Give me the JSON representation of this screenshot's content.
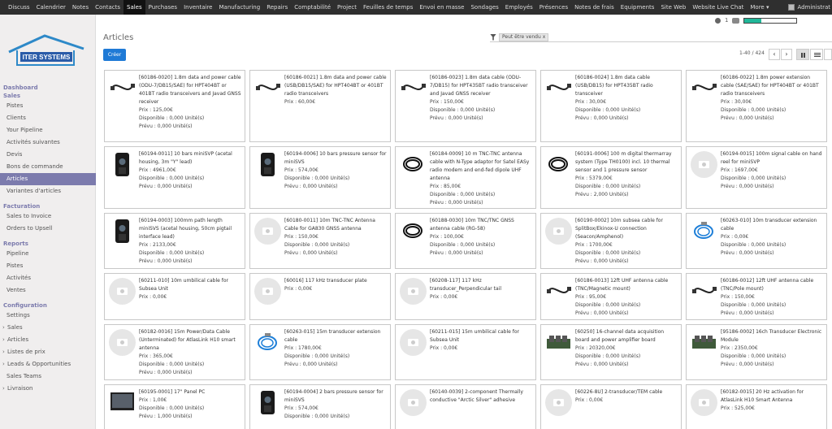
{
  "topbar": {
    "menu": [
      "Discuss",
      "Calendrier",
      "Notes",
      "Contacts",
      "Sales",
      "Purchases",
      "Inventaire",
      "Manufacturing",
      "Repairs",
      "Comptabilité",
      "Project",
      "Feuilles de temps",
      "Envoi en masse",
      "Sondages",
      "Employés",
      "Présences",
      "Notes de frais",
      "Equipments",
      "Site Web",
      "Website Live Chat",
      "More ▾"
    ],
    "active_menu": "Sales",
    "user": "Administrat",
    "notif_count": "1",
    "progress": 0.32,
    "accent": "#21b799"
  },
  "sidebar": {
    "logo_text": "ITER SYSTEMS",
    "groups": [
      {
        "title": "Dashboard",
        "items": []
      },
      {
        "title": "Sales",
        "items": [
          {
            "label": "Pistes"
          },
          {
            "label": "Clients"
          },
          {
            "label": "Your Pipeline"
          },
          {
            "label": "Activités suivantes"
          },
          {
            "label": "Devis"
          },
          {
            "label": "Bons de commande"
          },
          {
            "label": "Articles",
            "active": true
          },
          {
            "label": "Variantes d'articles"
          }
        ]
      },
      {
        "title": "Facturation",
        "items": [
          {
            "label": "Sales to Invoice"
          },
          {
            "label": "Orders to Upsell"
          }
        ]
      },
      {
        "title": "Reports",
        "items": [
          {
            "label": "Pipeline"
          },
          {
            "label": "Pistes"
          },
          {
            "label": "Activités"
          },
          {
            "label": "Ventes"
          }
        ]
      },
      {
        "title": "Configuration",
        "items": [
          {
            "label": "Settings"
          },
          {
            "label": "Sales",
            "caret": true
          },
          {
            "label": "Articles",
            "caret": true
          },
          {
            "label": "Listes de prix",
            "caret": true
          },
          {
            "label": "Leads & Opportunities",
            "caret": true
          },
          {
            "label": "Sales Teams"
          },
          {
            "label": "Livraison",
            "caret": true
          }
        ]
      }
    ],
    "accent": "#7c7bad"
  },
  "control": {
    "title": "Articles",
    "create_label": "Créer",
    "search_facet": "Peut être vendu",
    "pager": "1-40 / 424",
    "prev": "‹",
    "next": "›"
  },
  "products": [
    {
      "name": "[60186-0020] 1.8m data and power cable (ODU-7/DB15/SAE) for HPT404BT or 401BT radio transceivers and Javad GNSS receiver",
      "price": "Prix : 125,00€",
      "dispo": "Disponible : 0,000 Unité(s)",
      "prevu": "Prévu : 0,000 Unité(s)",
      "icon": "cable-icon"
    },
    {
      "name": "[60186-0021] 1.8m data and power cable (USB/DB15/SAE) for HPT404BT or 401BT radio transceivers",
      "price": "Prix : 60,00€",
      "dispo": "",
      "prevu": "",
      "icon": "cable-icon"
    },
    {
      "name": "[60186-0023] 1.8m data cable (ODU-7/DB15) for HPT435BT radio transceiver and Javad GNSS receiver",
      "price": "Prix : 150,00€",
      "dispo": "Disponible : 0,000 Unité(s)",
      "prevu": "Prévu : 0,000 Unité(s)",
      "icon": "cable-icon"
    },
    {
      "name": "[60186-0024] 1.8m data cable (USB/DB15) for HPT435BT radio transceiver",
      "price": "Prix : 30,00€",
      "dispo": "Disponible : 0,000 Unité(s)",
      "prevu": "Prévu : 0,000 Unité(s)",
      "icon": "cable-icon"
    },
    {
      "name": "[60186-0022] 1.8m power extension cable (SAE/SAE) for HPT404BT or 401BT radio transceivers",
      "price": "Prix : 30,00€",
      "dispo": "Disponible : 0,000 Unité(s)",
      "prevu": "Prévu : 0,000 Unité(s)",
      "icon": "cable-icon"
    },
    {
      "name": "[60194-0011] 10 bars miniSVP (acetal housing, 3m \"Y\" lead)",
      "price": "Prix : 4961,00€",
      "dispo": "Disponible : 0,000 Unité(s)",
      "prevu": "Prévu : 0,000 Unité(s)",
      "icon": "sensor-icon"
    },
    {
      "name": "[60194-0006] 10 bars pressure sensor for miniSVS",
      "price": "Prix : 574,00€",
      "dispo": "Disponible : 0,000 Unité(s)",
      "prevu": "Prévu : 0,000 Unité(s)",
      "icon": "sensor-icon"
    },
    {
      "name": "[60184-0009] 10 m TNC-TNC antenna cable with N-Type adaptor for Satel EASy radio modem and end-fed dipole UHF antenna",
      "price": "Prix : 85,00€",
      "dispo": "Disponible : 0,000 Unité(s)",
      "prevu": "Prévu : 0,000 Unité(s)",
      "icon": "coil-icon"
    },
    {
      "name": "[60191-0006] 100 m digital thermarray system (Type TH0100) incl. 10 thermal sensor and 1 pressure sensor",
      "price": "Prix : 5379,00€",
      "dispo": "Disponible : 0,000 Unité(s)",
      "prevu": "Prévu : 2,000 Unité(s)",
      "icon": "coil-icon"
    },
    {
      "name": "[60194-0015] 100m signal cable on hand reel for miniSVP",
      "price": "Prix : 1697,00€",
      "dispo": "Disponible : 0,000 Unité(s)",
      "prevu": "Prévu : 0,000 Unité(s)",
      "icon": "placeholder-icon"
    },
    {
      "name": "[60194-0003] 100mm path length miniSVS (acetal housing, 50cm pigtail interface lead)",
      "price": "Prix : 2133,00€",
      "dispo": "Disponible : 0,000 Unité(s)",
      "prevu": "Prévu : 0,000 Unité(s)",
      "icon": "sensor-icon"
    },
    {
      "name": "[60180-0011] 10m TNC-TNC Antenna Cable for GA830 GNSS antenna",
      "price": "Prix : 150,00€",
      "dispo": "Disponible : 0,000 Unité(s)",
      "prevu": "Prévu : 0,000 Unité(s)",
      "icon": "placeholder-icon"
    },
    {
      "name": "[60188-0030] 10m TNC/TNC GNSS antenna cable (RG-58)",
      "price": "Prix : 100,00€",
      "dispo": "Disponible : 0,000 Unité(s)",
      "prevu": "Prévu : 0,000 Unité(s)",
      "icon": "coil-icon"
    },
    {
      "name": "[60190-0002] 10m subsea cable for SplitBox/Ekinox-U connection (Seacon/Amphenol)",
      "price": "Prix : 1700,00€",
      "dispo": "Disponible : 0,000 Unité(s)",
      "prevu": "Prévu : 0,000 Unité(s)",
      "icon": "placeholder-icon"
    },
    {
      "name": "[60263-010] 10m transducer extension cable",
      "price": "Prix : 0,00€",
      "dispo": "Disponible : 0,000 Unité(s)",
      "prevu": "Prévu : 0,000 Unité(s)",
      "icon": "blue-coil-icon"
    },
    {
      "name": "[60211-010] 10m umbilical cable for Subsea Unit",
      "price": "Prix : 0,00€",
      "dispo": "",
      "prevu": "",
      "icon": "placeholder-icon"
    },
    {
      "name": "[60016] 117 kHz transducer plate",
      "price": "Prix : 0,00€",
      "dispo": "",
      "prevu": "",
      "icon": "placeholder-icon"
    },
    {
      "name": "[60208-117] 117 kHz transducer_Perpendicular tail",
      "price": "Prix : 0,00€",
      "dispo": "",
      "prevu": "",
      "icon": "placeholder-icon"
    },
    {
      "name": "[60186-0013] 12ft UHF antenna cable (TNC/Magnetic mount)",
      "price": "Prix : 95,00€",
      "dispo": "Disponible : 0,000 Unité(s)",
      "prevu": "Prévu : 0,000 Unité(s)",
      "icon": "cable-icon"
    },
    {
      "name": "[60186-0012] 12ft UHF antenna cable (TNC/Pole mount)",
      "price": "Prix : 150,00€",
      "dispo": "Disponible : 0,000 Unité(s)",
      "prevu": "Prévu : 0,000 Unité(s)",
      "icon": "cable-icon"
    },
    {
      "name": "[60182-0016] 15m Power/Data Cable (Unterminated) for AtlasLink H10 smart antenna",
      "price": "Prix : 365,00€",
      "dispo": "Disponible : 0,000 Unité(s)",
      "prevu": "Prévu : 0,000 Unité(s)",
      "icon": "placeholder-icon"
    },
    {
      "name": "[60263-015] 15m transducer extension cable",
      "price": "Prix : 1780,00€",
      "dispo": "Disponible : 0,000 Unité(s)",
      "prevu": "Prévu : 0,000 Unité(s)",
      "icon": "blue-coil-icon"
    },
    {
      "name": "[60211-015] 15m umbilical cable for Subsea Unit",
      "price": "Prix : 0,00€",
      "dispo": "",
      "prevu": "",
      "icon": "placeholder-icon"
    },
    {
      "name": "[60250] 16-channel data acquisition board and power amplifier board",
      "price": "Prix : 20320,00€",
      "dispo": "Disponible : 0,000 Unité(s)",
      "prevu": "Prévu : 0,000 Unité(s)",
      "icon": "board-icon"
    },
    {
      "name": "[95186-0002] 16ch Transducer Electronic Module",
      "price": "Prix : 2350,00€",
      "dispo": "Disponible : 0,000 Unité(s)",
      "prevu": "Prévu : 0,000 Unité(s)",
      "icon": "board-icon"
    },
    {
      "name": "[60195-0001] 17\" Panel PC",
      "price": "Prix : 1,00€",
      "dispo": "Disponible : 0,000 Unité(s)",
      "prevu": "Prévu : 1,000 Unité(s)",
      "icon": "screen-icon"
    },
    {
      "name": "[60194-0004] 2 bars pressure sensor for miniSVS",
      "price": "Prix : 574,00€",
      "dispo": "Disponible : 0,000 Unité(s)",
      "prevu": "",
      "icon": "sensor-icon"
    },
    {
      "name": "[60140-0039] 2-component Thermally conductive \"Arctic Silver\" adhesive",
      "price": "",
      "dispo": "",
      "prevu": "",
      "icon": "placeholder-icon"
    },
    {
      "name": "[60226-8U] 2-transducer/TEM cable",
      "price": "Prix : 0,00€",
      "dispo": "",
      "prevu": "",
      "icon": "placeholder-icon"
    },
    {
      "name": "[60182-0015] 20 Hz activation for AtlasLink H10 Smart Antenna",
      "price": "Prix : 525,00€",
      "dispo": "",
      "prevu": "",
      "icon": "placeholder-icon"
    }
  ]
}
